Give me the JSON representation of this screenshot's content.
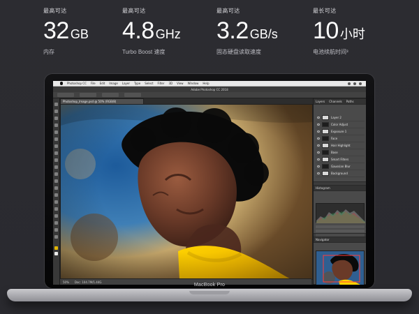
{
  "stats": [
    {
      "kicker": "最高可达",
      "value": "32",
      "unit": "GB",
      "label": "内存"
    },
    {
      "kicker": "最高可达",
      "value": "4.8",
      "unit": "GHz",
      "label": "Turbo Boost 速度"
    },
    {
      "kicker": "最高可达",
      "value": "3.2",
      "unit": "GB/s",
      "label": "固态硬盘读取速度"
    },
    {
      "kicker": "最长可达",
      "value": "10",
      "unit": "小时",
      "label": "电池续航时间³"
    }
  ],
  "device": {
    "model_label": "MacBook Pro"
  },
  "photoshop": {
    "menubar": [
      "Photoshop CC",
      "File",
      "Edit",
      "Image",
      "Layer",
      "Type",
      "Select",
      "Filter",
      "3D",
      "View",
      "Window",
      "Help"
    ],
    "app_title": "Adobe Photoshop CC 2018",
    "doc_tab": "Photoshop_Image.psd @ 50% (RGB/8)",
    "status": [
      "50%",
      "Doc: 104.7M/1.44G"
    ],
    "panels": {
      "layers_tabs": [
        "Layers",
        "Channels",
        "Paths"
      ],
      "histogram_title": "Histogram",
      "navigator_title": "Navigator",
      "layers": [
        {
          "name": "Layer 2",
          "thumb": "light"
        },
        {
          "name": "Color Adjust",
          "thumb": "dark"
        },
        {
          "name": "Exposure 1",
          "thumb": "light"
        },
        {
          "name": "Face",
          "thumb": "dark"
        },
        {
          "name": "Hair Highlight",
          "thumb": "light"
        },
        {
          "name": "Base",
          "thumb": "dark"
        },
        {
          "name": "Smart Filters",
          "thumb": "light"
        },
        {
          "name": "Gaussian Blur",
          "thumb": "dark"
        },
        {
          "name": "Background",
          "thumb": "light"
        }
      ]
    }
  },
  "colors": {
    "page_bg": "#2b2b30",
    "text_primary": "#ffffff",
    "text_secondary": "#bdbdc3",
    "accent_yellow": "#f5c400"
  }
}
